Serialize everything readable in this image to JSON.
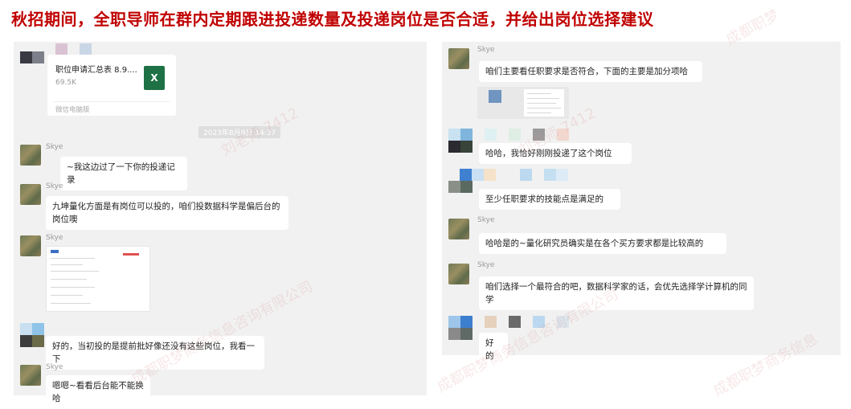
{
  "title": "秋招期间，全职导师在群内定期跟进投递数量及投递岗位是否合适，并给出岗位选择建议",
  "watermark": "成都职梦商务信息咨询有限公司 刘老师 7412",
  "left": {
    "file": {
      "name": "职位申请汇总表 8.9....",
      "size": "69.5K",
      "source": "微信电脑版",
      "icon_letter": "X"
    },
    "timestamp": "2023年8月9日 14:37",
    "messages": [
      {
        "sender": "Skye",
        "text": "~我这边过了一下你的投递记录"
      },
      {
        "sender": "Skye",
        "text": "九坤量化方面是有岗位可以投的，咱们投数据科学是偏后台的岗位噢"
      },
      {
        "sender": "Skye",
        "text": ""
      },
      {
        "sender": "",
        "text": "好的，当初投的是提前批好像还没有这些岗位，我看一下"
      },
      {
        "sender": "Skye",
        "text": "嗯嗯~看看后台能不能换哈"
      }
    ]
  },
  "right": {
    "messages": [
      {
        "sender": "Skye",
        "text": "咱们主要看任职要求是否符合，下面的主要是加分项哈"
      },
      {
        "sender": "",
        "text": "哈哈，我恰好刚刚投递了这个岗位"
      },
      {
        "sender": "",
        "text": "至少任职要求的技能点是满足的"
      },
      {
        "sender": "Skye",
        "text": "哈哈是的~量化研究员确实是在各个买方要求都是比较高的"
      },
      {
        "sender": "Skye",
        "text": "咱们选择一个最符合的吧，数据科学家的话，会优先选择学计算机的同学"
      },
      {
        "sender": "",
        "text": "好的"
      }
    ]
  },
  "colors": {
    "title": "#c00000",
    "panel_bg": "#f1f1f1",
    "bubble_bg": "#ffffff",
    "excel_green": "#1e7145"
  }
}
